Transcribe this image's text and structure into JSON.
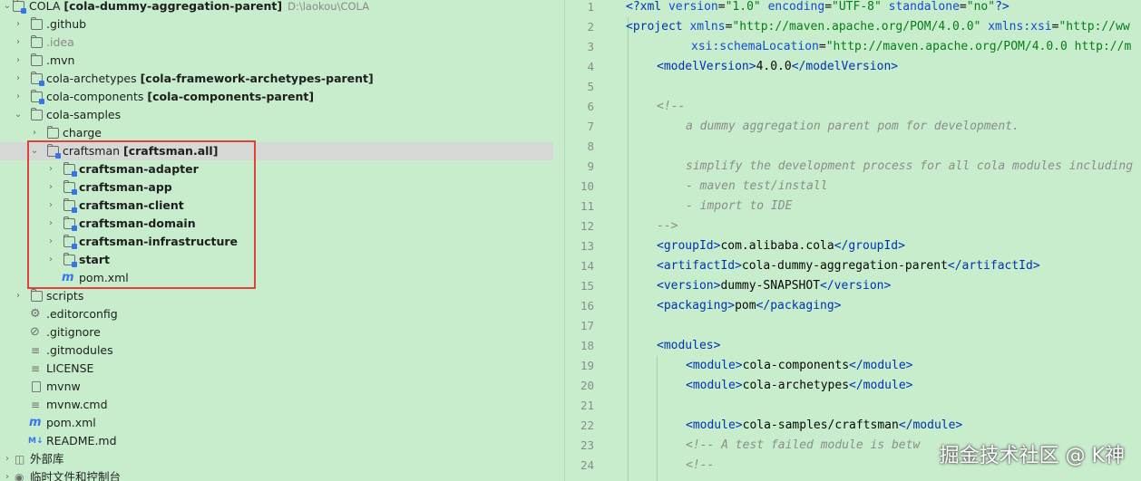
{
  "project": {
    "root_name": "COLA",
    "root_module": "[cola-dummy-aggregation-parent]",
    "root_path": "D:\\laokou\\COLA"
  },
  "tree_items": [
    {
      "label": ".github",
      "suffix": ""
    },
    {
      "label": ".idea",
      "suffix": ""
    },
    {
      "label": ".mvn",
      "suffix": ""
    },
    {
      "label": "cola-archetypes",
      "suffix": "[cola-framework-archetypes-parent]"
    },
    {
      "label": "cola-components",
      "suffix": "[cola-components-parent]"
    },
    {
      "label": "cola-samples",
      "suffix": ""
    },
    {
      "label": "charge",
      "suffix": ""
    },
    {
      "label": "craftsman",
      "suffix": "[craftsman.all]"
    },
    {
      "label": "craftsman-adapter",
      "suffix": ""
    },
    {
      "label": "craftsman-app",
      "suffix": ""
    },
    {
      "label": "craftsman-client",
      "suffix": ""
    },
    {
      "label": "craftsman-domain",
      "suffix": ""
    },
    {
      "label": "craftsman-infrastructure",
      "suffix": ""
    },
    {
      "label": "start",
      "suffix": ""
    },
    {
      "label": "pom.xml",
      "suffix": ""
    },
    {
      "label": "scripts",
      "suffix": ""
    },
    {
      "label": ".editorconfig",
      "suffix": ""
    },
    {
      "label": ".gitignore",
      "suffix": ""
    },
    {
      "label": ".gitmodules",
      "suffix": ""
    },
    {
      "label": "LICENSE",
      "suffix": ""
    },
    {
      "label": "mvnw",
      "suffix": ""
    },
    {
      "label": "mvnw.cmd",
      "suffix": ""
    },
    {
      "label": "pom.xml",
      "suffix": ""
    },
    {
      "label": "README.md",
      "suffix": ""
    },
    {
      "label": "外部库",
      "suffix": ""
    },
    {
      "label": "临时文件和控制台",
      "suffix": ""
    }
  ],
  "line_numbers": [
    "1",
    "2",
    "3",
    "4",
    "5",
    "6",
    "7",
    "8",
    "9",
    "10",
    "11",
    "12",
    "13",
    "14",
    "15",
    "16",
    "17",
    "18",
    "19",
    "20",
    "21",
    "22",
    "23",
    "24"
  ],
  "code": {
    "l1_decl": "<?xml ",
    "l1_a1": "version",
    "l1_v1": "\"1.0\"",
    "l1_a2": "encoding",
    "l1_v2": "\"UTF-8\"",
    "l1_a3": "standalone",
    "l1_v3": "\"no\"",
    "l1_end": "?>",
    "l2_tag": "<project ",
    "l2_a1": "xmlns",
    "l2_v1": "\"http://maven.apache.org/POM/4.0.0\"",
    "l2_a2": "xmlns:xsi",
    "l2_v2": "\"http://ww",
    "l3_a": "xsi:schemaLocation",
    "l3_v": "\"http://maven.apache.org/POM/4.0.0 http://m",
    "l4_open": "<modelVersion>",
    "l4_text": "4.0.0",
    "l4_close": "</modelVersion>",
    "l6": "<!--",
    "l7": "a dummy aggregation parent pom for development.",
    "l9": "simplify the development process for all cola modules including",
    "l10": "- maven test/install",
    "l11": "- import to IDE",
    "l12": "-->",
    "l13_open": "<groupId>",
    "l13_text": "com.alibaba.cola",
    "l13_close": "</groupId>",
    "l14_open": "<artifactId>",
    "l14_text": "cola-dummy-aggregation-parent",
    "l14_close": "</artifactId>",
    "l15_open": "<version>",
    "l15_text": "dummy-SNAPSHOT",
    "l15_close": "</version>",
    "l16_open": "<packaging>",
    "l16_text": "pom",
    "l16_close": "</packaging>",
    "l18": "<modules>",
    "mod_open": "<module>",
    "mod_close": "</module>",
    "l19_text": "cola-components",
    "l20_text": "cola-archetypes",
    "l22_text": "cola-samples/craftsman",
    "l23": "<!-- A test failed module is betw",
    "l24": "<!--"
  },
  "watermark": "掘金技术社区 @ K神"
}
